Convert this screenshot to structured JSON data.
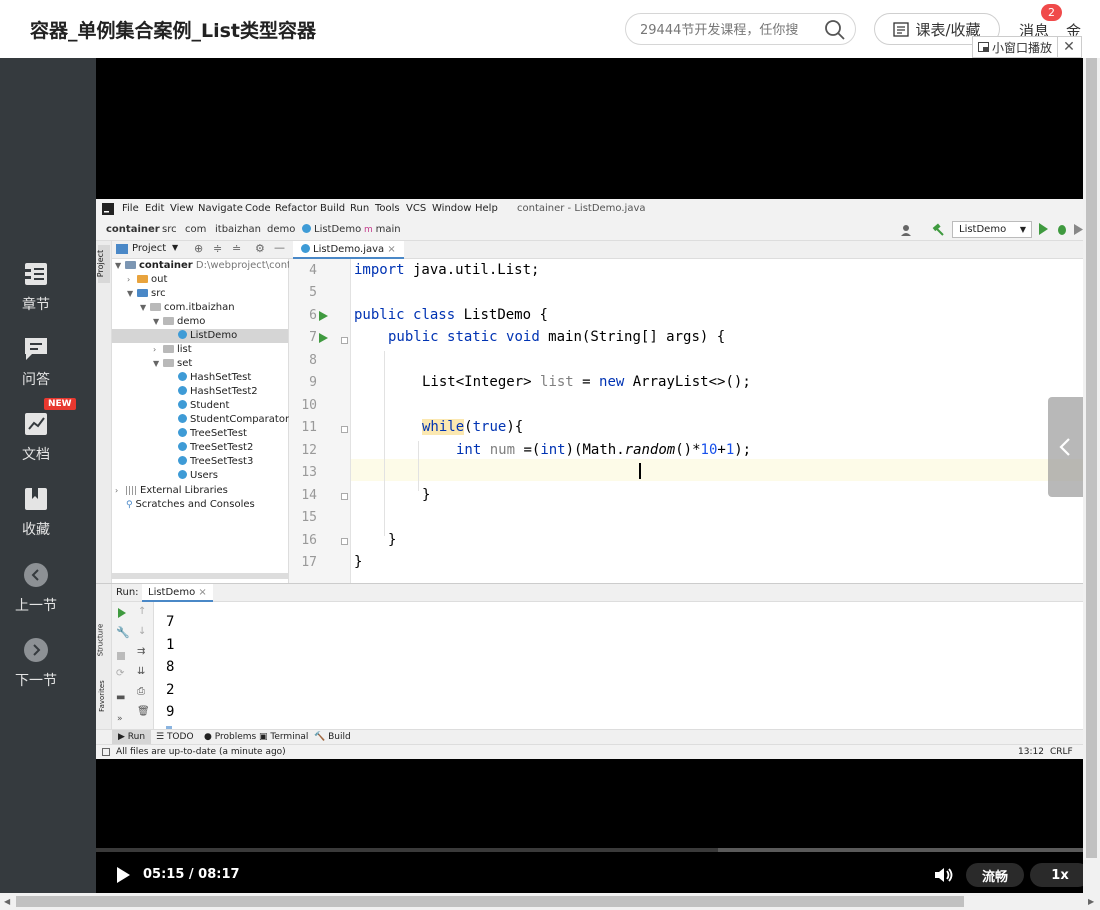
{
  "header": {
    "title": "容器_单例集合案例_List类型容器",
    "search_placeholder": "29444节开发课程，任你搜",
    "course_button": "课表/收藏",
    "messages_label": "消息",
    "messages_count": "2",
    "user_label_cut": "金"
  },
  "mini_player": {
    "label": "小窗口播放",
    "close": "✕"
  },
  "sidebar": {
    "items": [
      {
        "label": "章节"
      },
      {
        "label": "问答"
      },
      {
        "label": "文档"
      },
      {
        "label": "收藏"
      },
      {
        "label": "上一节"
      },
      {
        "label": "下一节"
      }
    ],
    "new_badge": "NEW"
  },
  "ide": {
    "menu": [
      "File",
      "Edit",
      "View",
      "Navigate",
      "Code",
      "Refactor",
      "Build",
      "Run",
      "Tools",
      "VCS",
      "Window",
      "Help"
    ],
    "window_title": "container - ListDemo.java",
    "breadcrumbs": [
      "container",
      "src",
      "com",
      "itbaizhan",
      "demo",
      "ListDemo",
      "main"
    ],
    "run_config": "ListDemo",
    "project_panel_title": "Project",
    "left_strip_label": "Project",
    "tree": [
      {
        "label": "container",
        "extra": "D:\\webproject\\containe"
      },
      {
        "label": "out"
      },
      {
        "label": "src"
      },
      {
        "label": "com.itbaizhan"
      },
      {
        "label": "demo"
      },
      {
        "label": "ListDemo"
      },
      {
        "label": "list"
      },
      {
        "label": "set"
      },
      {
        "label": "HashSetTest"
      },
      {
        "label": "HashSetTest2"
      },
      {
        "label": "Student"
      },
      {
        "label": "StudentComparator"
      },
      {
        "label": "TreeSetTest"
      },
      {
        "label": "TreeSetTest2"
      },
      {
        "label": "TreeSetTest3"
      },
      {
        "label": "Users"
      },
      {
        "label": "External Libraries"
      },
      {
        "label": "Scratches and Consoles"
      }
    ],
    "editor_tab": "ListDemo.java",
    "line_numbers": [
      "4",
      "5",
      "6",
      "7",
      "8",
      "9",
      "10",
      "11",
      "12",
      "13",
      "14",
      "15",
      "16",
      "17"
    ],
    "code": {
      "l4": [
        "import",
        " java.util.List;"
      ],
      "l6": [
        "public",
        " ",
        "class",
        " ListDemo {"
      ],
      "l7": [
        "public",
        " ",
        "static",
        " ",
        "void",
        " main(String[] args) {"
      ],
      "l9": [
        "List<Integer> ",
        "list",
        " = ",
        "new",
        " ArrayList<>();"
      ],
      "l11": [
        "while",
        "(",
        "true",
        "){"
      ],
      "l12": [
        "int",
        " ",
        "num",
        " =(",
        "int",
        ")(Math.",
        "random",
        "()*",
        "10",
        "+",
        "1",
        ");"
      ],
      "l14": "}",
      "l16": "}",
      "l17": "}"
    },
    "run_label": "Run:",
    "run_tab": "ListDemo",
    "output": [
      "7",
      "1",
      "8",
      "2",
      "9"
    ],
    "side_labels": [
      "Structure",
      "Favorites"
    ],
    "tool_tabs": [
      "Run",
      "TODO",
      "Problems",
      "Terminal",
      "Build"
    ],
    "status_text": "All files are up-to-date (a minute ago)",
    "status_pos": "13:12",
    "status_eol": "CRLF"
  },
  "player": {
    "time": "05:15 / 08:17",
    "progress": 0.63,
    "quality": "流畅",
    "speed": "1x"
  },
  "colors": {
    "sidebar_bg": "#353a3e",
    "badge_red": "#f04a4a",
    "keyword_blue": "#0033b3",
    "run_green": "#3f9a3f"
  }
}
